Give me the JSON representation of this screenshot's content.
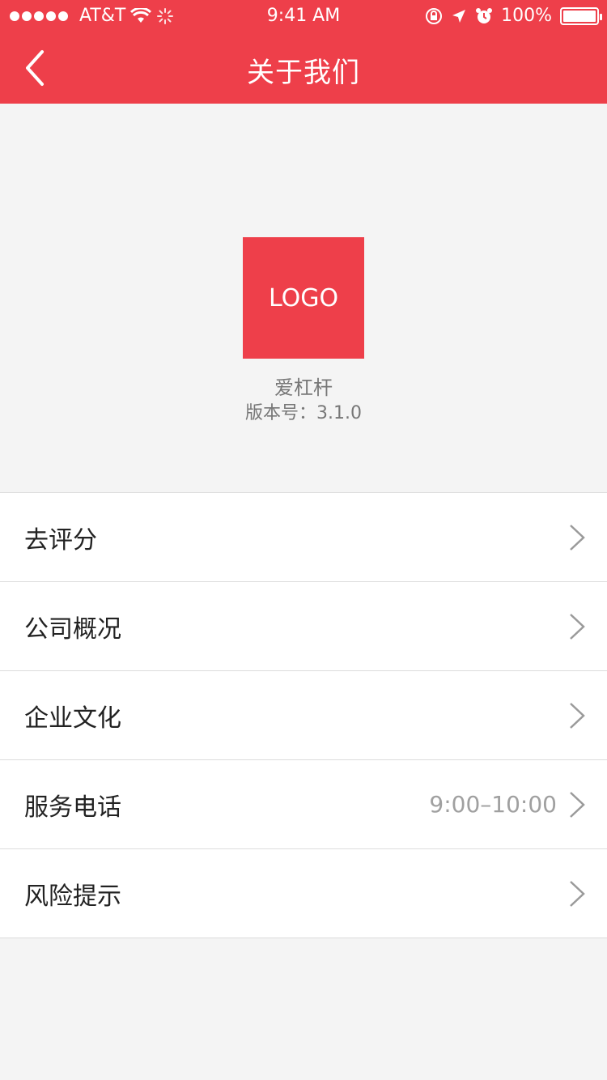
{
  "status_bar": {
    "carrier": "AT&T",
    "time": "9:41 AM",
    "battery": "100%"
  },
  "navbar": {
    "title": "关于我们",
    "back_icon": "chevron-left-icon"
  },
  "app": {
    "logo_text": "LOGO",
    "name": "爱杠杆",
    "version": "版本号：3.1.0"
  },
  "menu": [
    {
      "label": "去评分",
      "value": ""
    },
    {
      "label": "公司概况",
      "value": ""
    },
    {
      "label": "企业文化",
      "value": ""
    },
    {
      "label": "服务电话",
      "value": "9:00–10:00"
    },
    {
      "label": "风险提示",
      "value": ""
    }
  ],
  "colors": {
    "brand": "#ee3f4a",
    "background": "#f4f4f4"
  }
}
